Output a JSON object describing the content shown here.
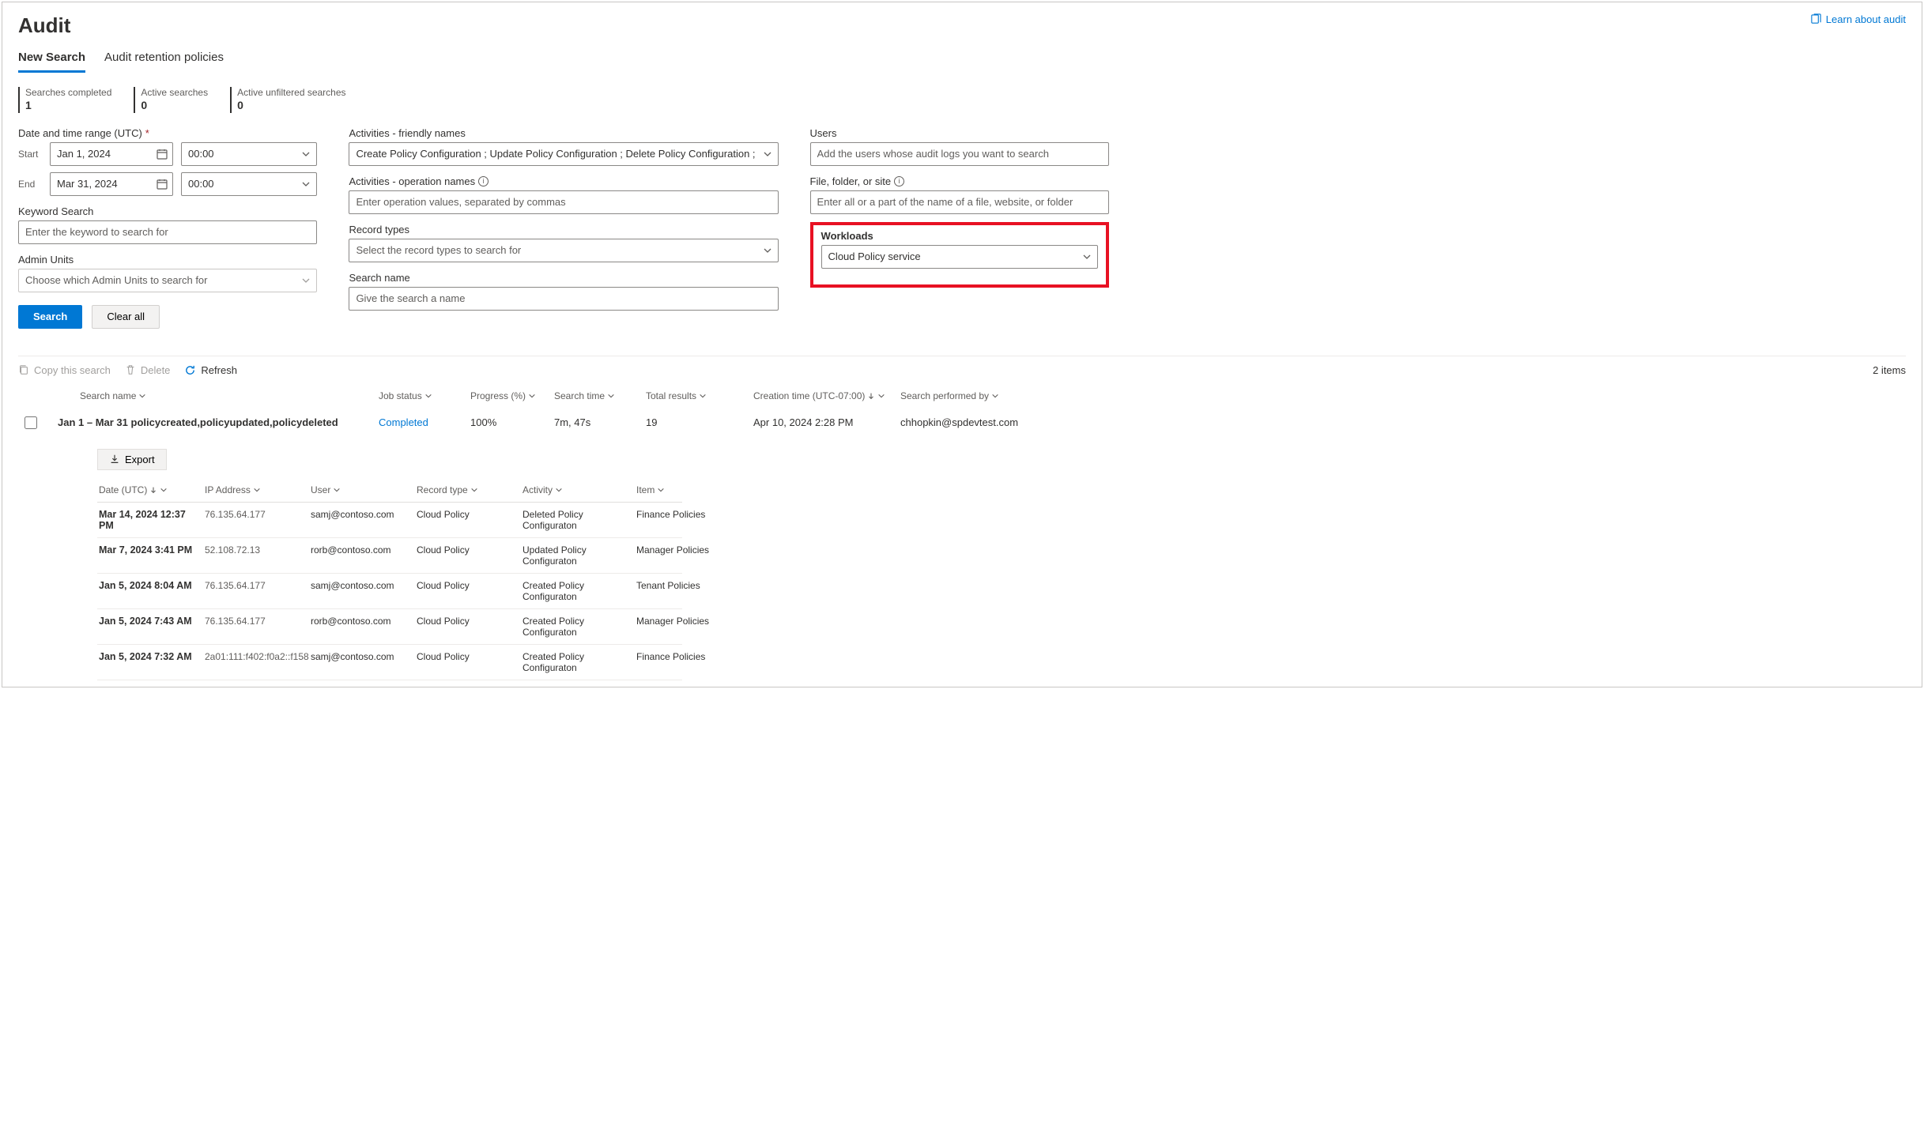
{
  "header": {
    "title": "Audit",
    "learn_link": "Learn about audit"
  },
  "tabs": [
    {
      "label": "New Search",
      "active": true
    },
    {
      "label": "Audit retention policies",
      "active": false
    }
  ],
  "stats": {
    "completed_label": "Searches completed",
    "completed_value": "1",
    "active_label": "Active searches",
    "active_value": "0",
    "unfiltered_label": "Active unfiltered searches",
    "unfiltered_value": "0"
  },
  "form": {
    "date_label": "Date and time range (UTC)",
    "start_label": "Start",
    "start_date": "Jan 1, 2024",
    "start_time": "00:00",
    "end_label": "End",
    "end_date": "Mar 31, 2024",
    "end_time": "00:00",
    "keyword_label": "Keyword Search",
    "keyword_ph": "Enter the keyword to search for",
    "admin_label": "Admin Units",
    "admin_ph": "Choose which Admin Units to search for",
    "friendly_label": "Activities - friendly names",
    "friendly_value": "Create Policy Configuration ;  Update Policy Configuration ; Delete Policy Configuration ;",
    "opnames_label": "Activities - operation names",
    "opnames_ph": "Enter operation values, separated by commas",
    "record_label": "Record types",
    "record_ph": "Select the record types to search for",
    "searchname_label": "Search name",
    "searchname_ph": "Give the search a name",
    "users_label": "Users",
    "users_ph": "Add the users whose audit logs you want to search",
    "ffs_label": "File, folder, or site",
    "ffs_ph": "Enter all or a part of the name of a file, website, or folder",
    "workloads_label": "Workloads",
    "workloads_value": "Cloud Policy service",
    "search_btn": "Search",
    "clear_btn": "Clear all"
  },
  "toolbar": {
    "copy": "Copy this search",
    "delete": "Delete",
    "refresh": "Refresh",
    "items": "2 items"
  },
  "grid": {
    "headers": {
      "name": "Search name",
      "status": "Job status",
      "progress": "Progress (%)",
      "time": "Search time",
      "total": "Total results",
      "creation": "Creation time (UTC-07:00)",
      "by": "Search performed by"
    },
    "row": {
      "name": "Jan 1 – Mar 31 policycreated,policyupdated,policydeleted",
      "status": "Completed",
      "progress": "100%",
      "time": "7m, 47s",
      "total": "19",
      "creation": "Apr 10, 2024 2:28 PM",
      "by": "chhopkin@spdevtest.com"
    }
  },
  "export_label": "Export",
  "detail": {
    "headers": {
      "date": "Date (UTC)",
      "ip": "IP Address",
      "user": "User",
      "record": "Record type",
      "activity": "Activity",
      "item": "Item"
    },
    "rows": [
      {
        "date": "Mar 14, 2024 12:37 PM",
        "ip": "76.135.64.177",
        "user": "samj@contoso.com",
        "record": "Cloud Policy",
        "activity": "Deleted Policy Configuraton",
        "item": "Finance Policies"
      },
      {
        "date": "Mar 7, 2024 3:41 PM",
        "ip": "52.108.72.13",
        "user": "rorb@contoso.com",
        "record": "Cloud Policy",
        "activity": "Updated Policy Configuraton",
        "item": "Manager Policies"
      },
      {
        "date": "Jan 5, 2024 8:04 AM",
        "ip": "76.135.64.177",
        "user": "samj@contoso.com",
        "record": "Cloud Policy",
        "activity": "Created Policy Configuraton",
        "item": "Tenant Policies"
      },
      {
        "date": "Jan 5, 2024 7:43 AM",
        "ip": "76.135.64.177",
        "user": "rorb@contoso.com",
        "record": "Cloud Policy",
        "activity": "Created Policy Configuraton",
        "item": "Manager Policies"
      },
      {
        "date": "Jan 5, 2024 7:32 AM",
        "ip": "2a01:111:f402:f0a2::f158",
        "user": "samj@contoso.com",
        "record": "Cloud Policy",
        "activity": "Created Policy Configuraton",
        "item": "Finance Policies"
      }
    ]
  }
}
